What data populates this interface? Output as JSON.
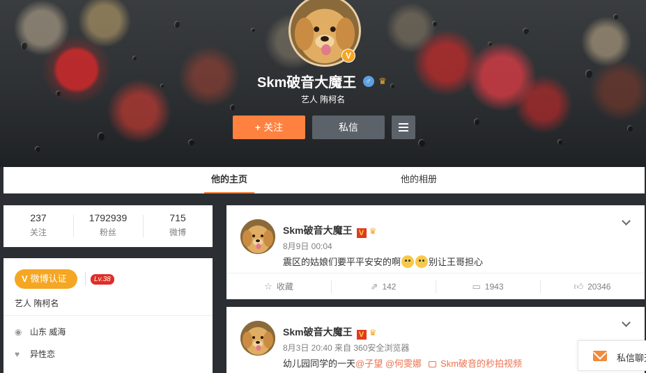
{
  "profile": {
    "name": "Skm破音大魔王",
    "subtitle": "艺人 陏柯名",
    "verified_badge": "V",
    "gender_icon": "male-icon",
    "follow_label": "关注",
    "follow_plus": "+",
    "message_label": "私信"
  },
  "tabs": {
    "home": "他的主页",
    "album": "他的相册"
  },
  "stats": [
    {
      "value": "237",
      "label": "关注"
    },
    {
      "value": "1792939",
      "label": "粉丝"
    },
    {
      "value": "715",
      "label": "微博"
    }
  ],
  "info": {
    "verify_label": "微博认证",
    "verify_v": "V",
    "level": "Lv.38",
    "description": "艺人 陏柯名",
    "location": "山东 威海",
    "relationship": "异性恋"
  },
  "posts": [
    {
      "author": "Skm破音大魔王",
      "badge": "V",
      "time": "8月9日 00:04",
      "text_before": "震区的姑娘们要平平安安的啊",
      "text_after": "别让王哥担心",
      "actions": {
        "favorite": "收藏",
        "repost": "142",
        "comment": "1943",
        "like": "20346"
      }
    },
    {
      "author": "Skm破音大魔王",
      "badge": "V",
      "time": "8月3日 20:40 来自 360安全浏览器",
      "text": "幼儿园同学的一天",
      "mention1": "@子望",
      "mention2": "@何雯娜",
      "video_link": "Skm破音的秒拍视频"
    }
  ],
  "chat": {
    "label": "私信聊天"
  },
  "colors": {
    "accent": "#ff8140",
    "link": "#eb7350",
    "verified": "#f5a623",
    "level": "#e02c2c"
  }
}
